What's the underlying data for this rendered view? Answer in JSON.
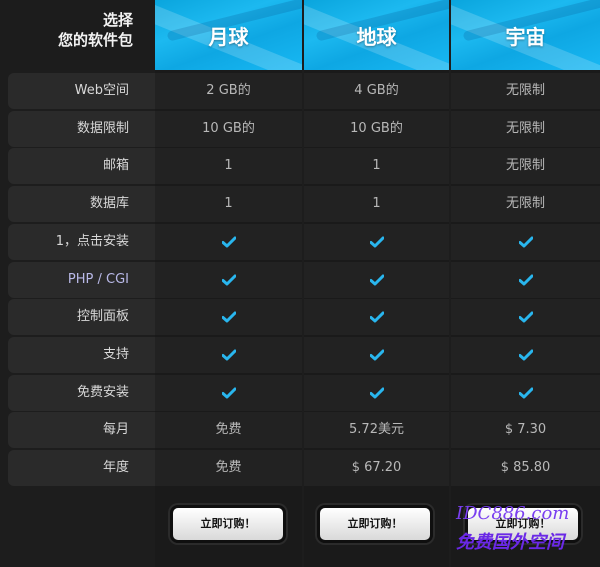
{
  "header": {
    "corner_line1": "选择",
    "corner_line2": "您的软件包",
    "plans": [
      "月球",
      "地球",
      "宇宙"
    ]
  },
  "rows": [
    {
      "label": "Web空间",
      "values": [
        "2 GB的",
        "4 GB的",
        "无限制"
      ]
    },
    {
      "label": "数据限制",
      "values": [
        "10 GB的",
        "10 GB的",
        "无限制"
      ]
    },
    {
      "label": "邮箱",
      "values": [
        "1",
        "1",
        "无限制"
      ]
    },
    {
      "label": "数据库",
      "values": [
        "1",
        "1",
        "无限制"
      ]
    },
    {
      "label": "1，点击安装",
      "values": [
        "check",
        "check",
        "check"
      ]
    },
    {
      "label": "PHP / CGI",
      "values": [
        "check",
        "check",
        "check"
      ]
    },
    {
      "label": "控制面板",
      "values": [
        "check",
        "check",
        "check"
      ]
    },
    {
      "label": "支持",
      "values": [
        "check",
        "check",
        "check"
      ]
    },
    {
      "label": "免费安装",
      "values": [
        "check",
        "check",
        "check"
      ]
    },
    {
      "label": "每月",
      "values": [
        "免费",
        "5.72美元",
        "$ 7.30"
      ]
    },
    {
      "label": "年度",
      "values": [
        "免费",
        "$ 67.20",
        "$ 85.80"
      ]
    }
  ],
  "order_label": "立即订购！",
  "watermark": {
    "line1": "IDC886.com",
    "line2": "免费国外空间"
  },
  "colors": {
    "accent": "#1cb9f0",
    "check": "#29b6ee"
  }
}
